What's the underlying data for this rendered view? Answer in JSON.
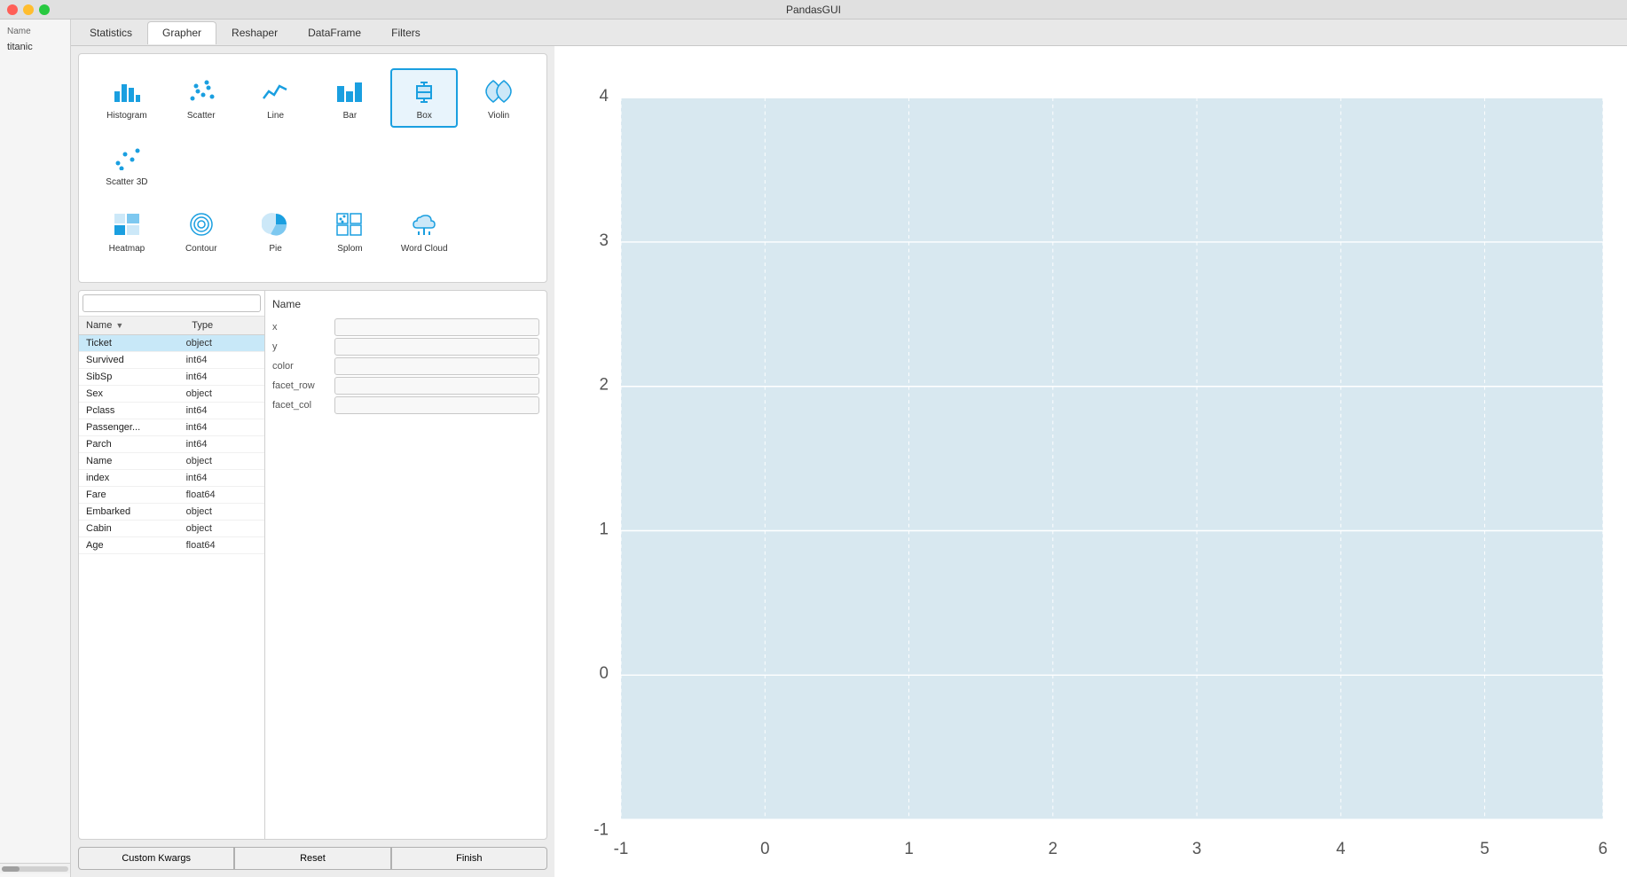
{
  "titlebar": {
    "title": "PandasGUI"
  },
  "sidebar": {
    "header": "Name",
    "items": [
      {
        "label": "titanic"
      }
    ]
  },
  "tabs": [
    {
      "label": "Statistics",
      "active": false
    },
    {
      "label": "Grapher",
      "active": true
    },
    {
      "label": "Reshaper",
      "active": false
    },
    {
      "label": "DataFrame",
      "active": false
    },
    {
      "label": "Filters",
      "active": false
    }
  ],
  "chart_types": [
    {
      "id": "histogram",
      "label": "Histogram",
      "selected": false
    },
    {
      "id": "scatter",
      "label": "Scatter",
      "selected": false
    },
    {
      "id": "line",
      "label": "Line",
      "selected": false
    },
    {
      "id": "bar",
      "label": "Bar",
      "selected": false
    },
    {
      "id": "box",
      "label": "Box",
      "selected": true
    },
    {
      "id": "violin",
      "label": "Violin",
      "selected": false
    },
    {
      "id": "scatter3d",
      "label": "Scatter 3D",
      "selected": false
    },
    {
      "id": "heatmap",
      "label": "Heatmap",
      "selected": false
    },
    {
      "id": "contour",
      "label": "Contour",
      "selected": false
    },
    {
      "id": "pie",
      "label": "Pie",
      "selected": false
    },
    {
      "id": "splom",
      "label": "Splom",
      "selected": false
    },
    {
      "id": "wordcloud",
      "label": "Word Cloud",
      "selected": false
    }
  ],
  "var_list": {
    "search_placeholder": "",
    "col_name": "Name",
    "col_type": "Type",
    "rows": [
      {
        "name": "Ticket",
        "type": "object",
        "selected": true
      },
      {
        "name": "Survived",
        "type": "int64",
        "selected": false
      },
      {
        "name": "SibSp",
        "type": "int64",
        "selected": false
      },
      {
        "name": "Sex",
        "type": "object",
        "selected": false
      },
      {
        "name": "Pclass",
        "type": "int64",
        "selected": false
      },
      {
        "name": "Passenger...",
        "type": "int64",
        "selected": false
      },
      {
        "name": "Parch",
        "type": "int64",
        "selected": false
      },
      {
        "name": "Name",
        "type": "object",
        "selected": false
      },
      {
        "name": "index",
        "type": "int64",
        "selected": false
      },
      {
        "name": "Fare",
        "type": "float64",
        "selected": false
      },
      {
        "name": "Embarked",
        "type": "object",
        "selected": false
      },
      {
        "name": "Cabin",
        "type": "object",
        "selected": false
      },
      {
        "name": "Age",
        "type": "float64",
        "selected": false
      }
    ]
  },
  "drop_targets": {
    "header": "Name",
    "fields": [
      {
        "id": "x",
        "label": "x"
      },
      {
        "id": "y",
        "label": "y"
      },
      {
        "id": "color",
        "label": "color"
      },
      {
        "id": "facet_row",
        "label": "facet_row"
      },
      {
        "id": "facet_col",
        "label": "facet_col"
      }
    ]
  },
  "buttons": {
    "custom": "Custom Kwargs",
    "reset": "Reset",
    "finish": "Finish"
  },
  "chart": {
    "y_labels": [
      "4",
      "3",
      "2",
      "1",
      "0",
      "-1"
    ],
    "x_labels": [
      "-1",
      "0",
      "1",
      "2",
      "3",
      "4",
      "5",
      "6"
    ]
  }
}
